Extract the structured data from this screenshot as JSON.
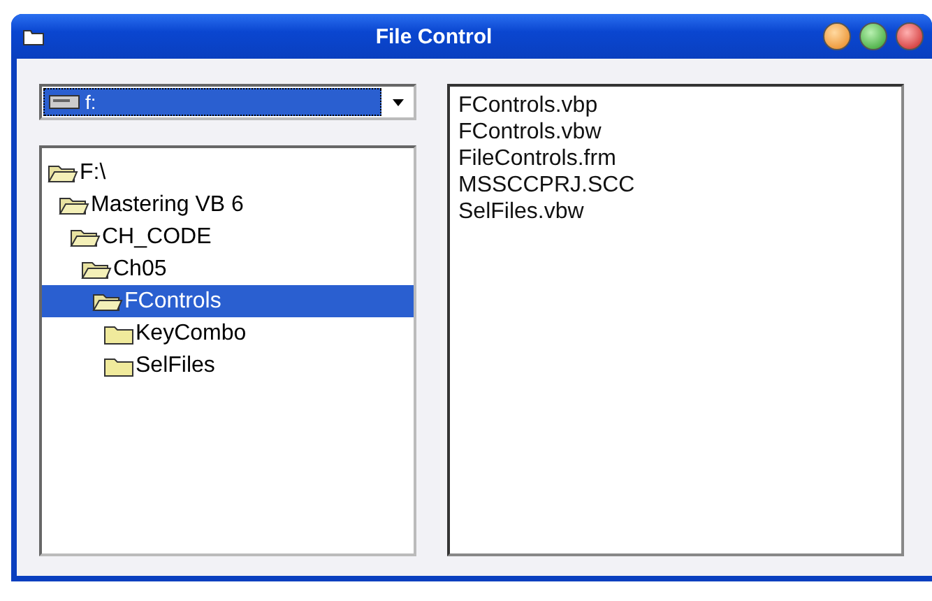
{
  "window": {
    "title": "File Control"
  },
  "drive": {
    "value": "f:"
  },
  "folders": [
    {
      "name": "F:\\",
      "kind": "open",
      "selected": false,
      "children": [
        {
          "name": "Mastering VB 6",
          "kind": "open",
          "selected": false,
          "children": [
            {
              "name": "CH_CODE",
              "kind": "open",
              "selected": false,
              "children": [
                {
                  "name": "Ch05",
                  "kind": "open",
                  "selected": false,
                  "children": [
                    {
                      "name": "FControls",
                      "kind": "open",
                      "selected": true,
                      "children": [
                        {
                          "name": "KeyCombo",
                          "kind": "closed",
                          "selected": false
                        },
                        {
                          "name": "SelFiles",
                          "kind": "closed",
                          "selected": false
                        }
                      ]
                    }
                  ]
                }
              ]
            }
          ]
        }
      ]
    }
  ],
  "files": [
    "FControls.vbp",
    "FControls.vbw",
    "FileControls.frm",
    "MSSCCPRJ.SCC",
    "SelFiles.vbw"
  ]
}
